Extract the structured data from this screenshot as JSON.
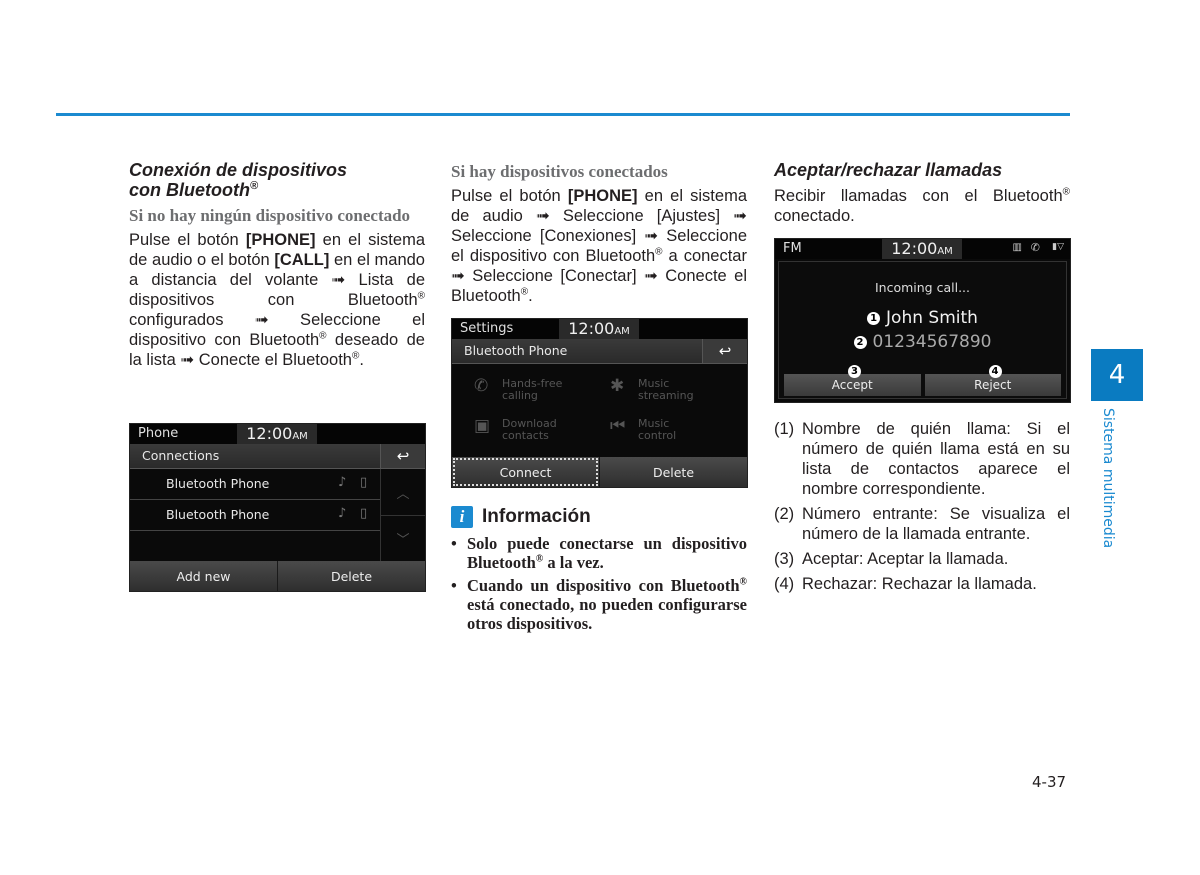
{
  "colors": {
    "accent": "#1b8ad0",
    "chapter_tab": "#0a7bc1",
    "subheading_gray": "#6d6e70"
  },
  "col1": {
    "heading_line1": "Conexión de dispositivos",
    "heading_line2": "con Bluetooth",
    "heading_reg": "®",
    "subheading": "Si no hay ningún dispositivo conectado",
    "p_a": "Pulse el botón ",
    "p_phone": "[PHONE]",
    "p_b": " en el sistema de audio o el botón ",
    "p_call": "[CALL]",
    "p_c": " en el mando a distancia del volante ➟ Lista de dispositivos con Bluetooth",
    "p_d": " configurados ➟ Seleccione el dispositivo con Bluetooth",
    "p_e": " deseado de la lista ➟ Conecte el Bluetooth",
    "p_f": ".",
    "reg": "®",
    "screen": {
      "status_left": "Phone",
      "clock": "12:00",
      "clock_suffix": "AM",
      "title": "Connections",
      "back_icon": "↩",
      "rows": [
        {
          "label": "Bluetooth Phone",
          "audio_icon": "♪",
          "phone_icon": "▯"
        },
        {
          "label": "Bluetooth Phone",
          "audio_icon": "♪",
          "phone_icon": "▯"
        }
      ],
      "scroll_up": "︿",
      "scroll_down": "﹀",
      "buttons": [
        "Add new",
        "Delete"
      ]
    }
  },
  "col2": {
    "subheading": "Si hay dispositivos conectados",
    "p_a": "Pulse el botón ",
    "p_phone": "[PHONE]",
    "p_b": " en el sistema de audio ➟ Seleccione [Ajustes] ➟ Seleccione [Conexiones] ➟ Seleccione el dispositivo con Bluetooth",
    "p_c": " a conectar ➟ Seleccione [Conectar] ➟ Conecte el Bluetooth",
    "p_d": ".",
    "reg": "®",
    "screen": {
      "status_left": "Settings",
      "clock": "12:00",
      "clock_suffix": "AM",
      "title": "Bluetooth Phone",
      "back_icon": "↩",
      "features": [
        {
          "icon": "✆",
          "line1": "Hands-free",
          "line2": "calling"
        },
        {
          "icon": "✱",
          "line1": "Music",
          "line2": "streaming"
        },
        {
          "icon": "▣",
          "line1": "Download",
          "line2": "contacts"
        },
        {
          "icon": "⏮",
          "line1": "Music",
          "line2": "control"
        }
      ],
      "buttons": [
        "Connect",
        "Delete"
      ]
    },
    "info": {
      "icon": "i",
      "title": "Información",
      "items": [
        {
          "a": "Solo puede conectarse un dispositivo Bluetooth",
          "b": " a la vez."
        },
        {
          "a": "Cuando un dispositivo con Bluetooth",
          "b": " está conectado, no pueden configurarse otros dispositivos."
        }
      ]
    }
  },
  "col3": {
    "heading": "Aceptar/rechazar llamadas",
    "intro_a": "Recibir llamadas con el Bluetooth",
    "intro_b": " conectado.",
    "reg": "®",
    "screen": {
      "status_left": "FM",
      "clock": "12:00",
      "clock_suffix": "AM",
      "status_icons": [
        "▥",
        "✆",
        "▮▽"
      ],
      "incoming": "Incoming call...",
      "caller_name": "John Smith",
      "caller_number": "01234567890",
      "callouts": [
        "1",
        "2",
        "3",
        "4"
      ],
      "buttons": [
        "Accept",
        "Reject"
      ]
    },
    "list": [
      {
        "n": "(1)",
        "text": "Nombre de quién llama: Si el número de quién llama está en su lista de contactos aparece el nombre correspondiente."
      },
      {
        "n": "(2)",
        "text": "Número entrante: Se visualiza el número de la llamada entrante."
      },
      {
        "n": "(3)",
        "text": "Aceptar: Aceptar la llamada."
      },
      {
        "n": "(4)",
        "text": "Rechazar: Rechazar la llamada."
      }
    ]
  },
  "chapter": {
    "number": "4",
    "label": "Sistema multimedia"
  },
  "page_number": "4-37"
}
